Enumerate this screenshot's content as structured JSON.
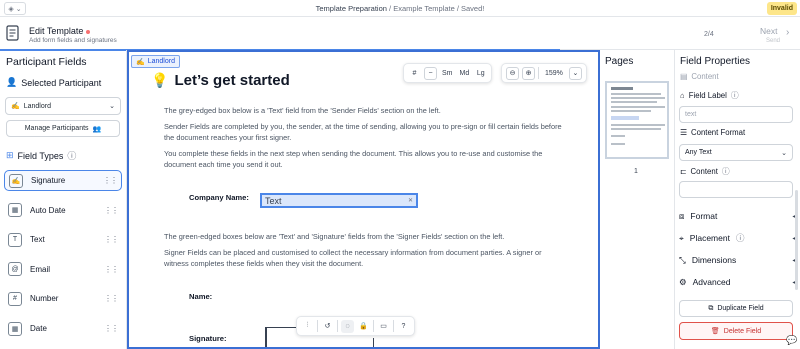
{
  "topbar": {
    "crumb_main": "Template Preparation",
    "crumb_sep": " / ",
    "crumb_rest": "Example Template / Saved!",
    "status_badge": "Invalid",
    "status_color": "#fde68a"
  },
  "header": {
    "title": "Edit Template",
    "subtitle": "Add form fields and signatures",
    "step": "2/4",
    "next_label": "Next",
    "next_sub": "Send",
    "progress": 0.7
  },
  "left": {
    "heading": "Participant Fields",
    "selected_heading": "Selected Participant",
    "participant": "Landlord",
    "manage_label": "Manage Participants",
    "field_types_heading": "Field Types",
    "field_types": [
      {
        "label": "Signature",
        "icon": "signature-icon",
        "glyph": "✍"
      },
      {
        "label": "Auto Date",
        "icon": "calendar-icon",
        "glyph": "▦"
      },
      {
        "label": "Text",
        "icon": "text-icon",
        "glyph": "T"
      },
      {
        "label": "Email",
        "icon": "at-icon",
        "glyph": "@"
      },
      {
        "label": "Number",
        "icon": "hash-icon",
        "glyph": "#"
      },
      {
        "label": "Date",
        "icon": "calendar-icon",
        "glyph": "▦"
      }
    ]
  },
  "canvas": {
    "participant_tag": "Landlord",
    "heading": "Let’s get started",
    "p1": "The grey-edged box below is a 'Text' field from the 'Sender Fields' section on the left.",
    "p2": "Sender Fields are completed by you, the sender, at the time of sending, allowing you to pre-sign or fill certain fields before the document reaches your first signer.",
    "p3": "You complete these fields in the next step when sending the document. This allows you to re-use and customise the document each time you send it out.",
    "company_label": "Company Name:",
    "text_field_value": "Text",
    "p4": "The green-edged boxes below are 'Text' and 'Signature' fields from the 'Signer Fields' section on the left.",
    "p5": "Signer Fields can be placed and customised to collect the necessary information from document parties. A signer or witness completes these fields when they visit the document.",
    "name_label": "Name:",
    "signature_label": "Signature:",
    "toolbar": {
      "sizes": [
        "Sm",
        "Md",
        "Lg"
      ],
      "zoom": "159%"
    }
  },
  "pages": {
    "heading": "Pages",
    "page_number": "1"
  },
  "right": {
    "heading": "Field Properties",
    "content_section": "Content",
    "field_label_heading": "Field Label",
    "field_label_placeholder": "text",
    "content_format_heading": "Content Format",
    "content_format_value": "Any Text",
    "content_heading": "Content",
    "sections": [
      {
        "label": "Format",
        "icon": "format-icon"
      },
      {
        "label": "Placement",
        "icon": "placement-icon"
      },
      {
        "label": "Dimensions",
        "icon": "dimensions-icon"
      },
      {
        "label": "Advanced",
        "icon": "gear-icon"
      }
    ],
    "duplicate_label": "Duplicate Field",
    "delete_label": "Delete Field",
    "delete_color": "#e0524a"
  }
}
